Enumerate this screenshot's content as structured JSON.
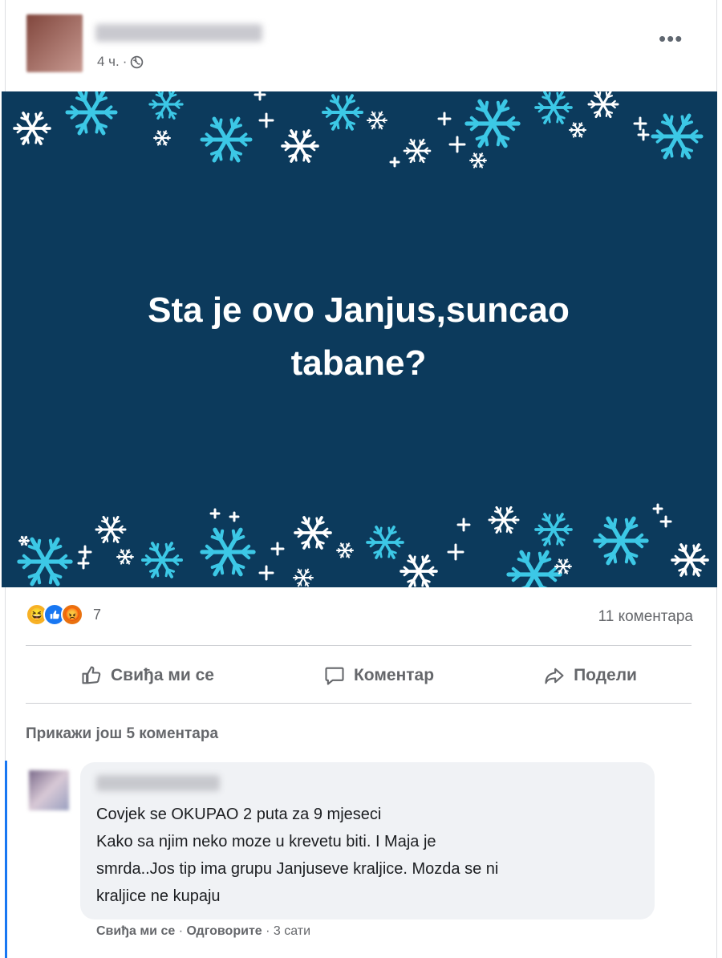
{
  "post": {
    "time": "4 ч.",
    "time_separator": "·",
    "icons": {
      "privacy": "globe-icon",
      "menu": "more-options-icon"
    },
    "banner_text_line1": "Sta je ovo Janjus,suncao",
    "banner_text_line2": "tabane?",
    "banner_color": "#0c3a5c",
    "snowflake_color_a": "#3cc8e6",
    "snowflake_color_b": "#ffffff"
  },
  "reactions": {
    "icons": [
      "haha-reaction-icon",
      "like-reaction-icon",
      "angry-reaction-icon"
    ],
    "count": "7",
    "comments": "11 коментара"
  },
  "actions": {
    "like": "Свиђа ми се",
    "comment": "Коментар",
    "share": "Подели"
  },
  "comments": {
    "more": "Прикажи још 5 коментара",
    "first": {
      "line1": "Covjek se OKUPAO 2 puta za 9 mjeseci",
      "line2": "Kako sa njim neko moze u krevetu biti. I Maja je",
      "line3": "smrda..Jos tip ima grupu Janjuseve kraljice. Mozda se ni",
      "line4": "kraljice ne kupaju",
      "like": "Свиђа ми се",
      "reply": "Одговорите",
      "time": "3 сати",
      "separator": "·"
    }
  },
  "colors": {
    "accent": "#1877f2",
    "secondary_text": "#65676b"
  }
}
